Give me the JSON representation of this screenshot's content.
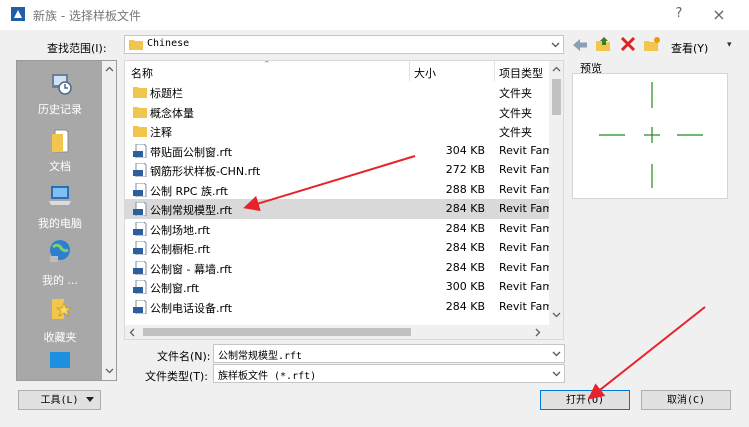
{
  "window": {
    "title": "新族 - 选择样板文件",
    "help": "?",
    "close": "×"
  },
  "lookin": {
    "label": "查找范围(I):",
    "value": "Chinese"
  },
  "toolbar": {
    "views_label": "查看(Y)",
    "views_arrow": "▾"
  },
  "places": [
    {
      "label": "历史记录",
      "icon": "history-icon"
    },
    {
      "label": "文档",
      "icon": "documents-icon"
    },
    {
      "label": "我的电脑",
      "icon": "computer-icon"
    },
    {
      "label": "我的 ...",
      "icon": "network-icon"
    },
    {
      "label": "收藏夹",
      "icon": "favorites-icon"
    }
  ],
  "filelist": {
    "columns": {
      "name": "名称",
      "size": "大小",
      "type": "项目类型"
    },
    "rows": [
      {
        "name": "标题栏",
        "size": "",
        "type": "文件夹",
        "kind": "folder"
      },
      {
        "name": "概念体量",
        "size": "",
        "type": "文件夹",
        "kind": "folder"
      },
      {
        "name": "注释",
        "size": "",
        "type": "文件夹",
        "kind": "folder"
      },
      {
        "name": "带贴面公制窗.rft",
        "size": "304 KB",
        "type": "Revit Fam",
        "kind": "rft"
      },
      {
        "name": "钢筋形状样板-CHN.rft",
        "size": "272 KB",
        "type": "Revit Fam",
        "kind": "rft"
      },
      {
        "name": "公制 RPC 族.rft",
        "size": "288 KB",
        "type": "Revit Fam",
        "kind": "rft"
      },
      {
        "name": "公制常规模型.rft",
        "size": "284 KB",
        "type": "Revit Fam",
        "kind": "rft",
        "state": "hover"
      },
      {
        "name": "公制场地.rft",
        "size": "284 KB",
        "type": "Revit Fam",
        "kind": "rft"
      },
      {
        "name": "公制橱柜.rft",
        "size": "284 KB",
        "type": "Revit Fam",
        "kind": "rft"
      },
      {
        "name": "公制窗 - 幕墙.rft",
        "size": "284 KB",
        "type": "Revit Fam",
        "kind": "rft"
      },
      {
        "name": "公制窗.rft",
        "size": "300 KB",
        "type": "Revit Fam",
        "kind": "rft"
      },
      {
        "name": "公制电话设备.rft",
        "size": "284 KB",
        "type": "Revit Fam",
        "kind": "rft"
      }
    ]
  },
  "preview": {
    "label": "预览"
  },
  "filename": {
    "label": "文件名(N):",
    "value": "公制常规模型.rft"
  },
  "filetype": {
    "label": "文件类型(T):",
    "value": "族样板文件 (*.rft)"
  },
  "buttons": {
    "tools": "工具(L)",
    "open": "打开(O)",
    "cancel": "取消(C)"
  },
  "colors": {
    "accent": "#0078d7",
    "annotation_arrow": "#e8222a",
    "preview_crosshair": "#1e8a1e",
    "folder": "#f2c54d"
  }
}
